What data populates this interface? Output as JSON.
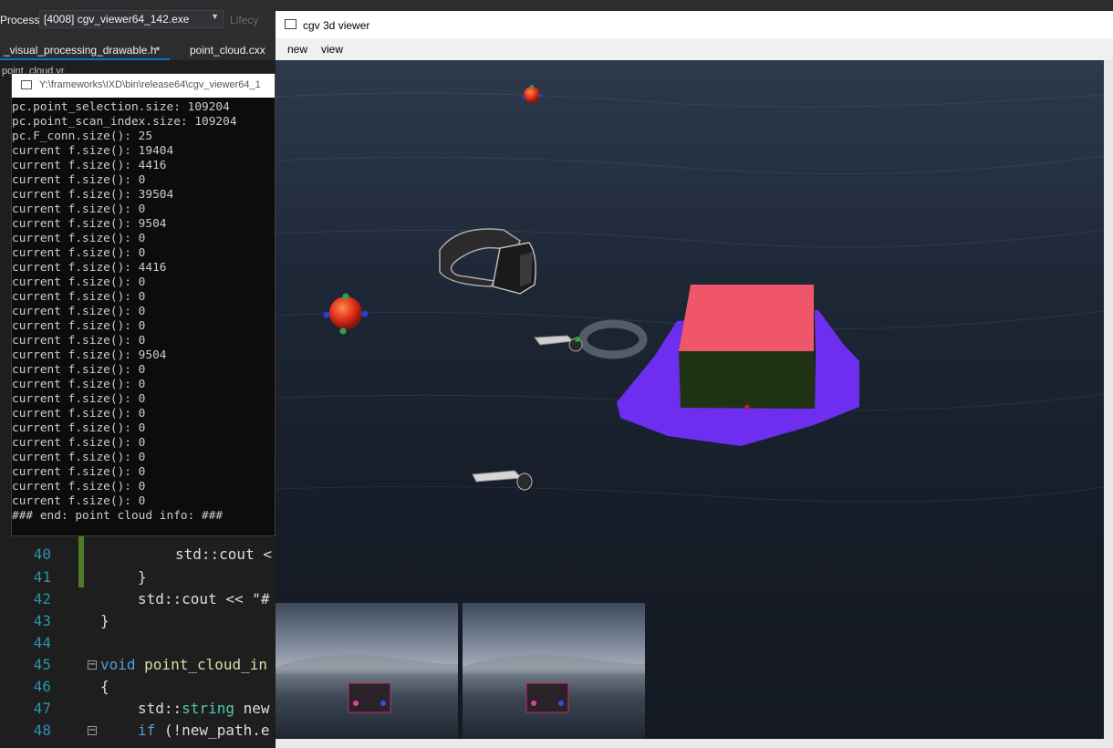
{
  "vs": {
    "process_label": "Process:",
    "process_value": "[4008] cgv_viewer64_142.exe",
    "lifecycle_label": "Lifecy",
    "tabs": [
      {
        "label": "_visual_processing_drawable.h"
      },
      {
        "label": "⭒"
      },
      {
        "label": "point_cloud.cxx"
      }
    ],
    "tab_row2": "point_cloud.vr"
  },
  "console": {
    "title": "Y:\\frameworks\\IXD\\bin\\release64\\cgv_viewer64_1",
    "lines": [
      "pc.point_selection.size: 109204",
      "pc.point_scan_index.size: 109204",
      "pc.F_conn.size(): 25",
      "current f.size(): 19404",
      "current f.size(): 4416",
      "current f.size(): 0",
      "current f.size(): 39504",
      "current f.size(): 0",
      "current f.size(): 9504",
      "current f.size(): 0",
      "current f.size(): 0",
      "current f.size(): 4416",
      "current f.size(): 0",
      "current f.size(): 0",
      "current f.size(): 0",
      "current f.size(): 0",
      "current f.size(): 0",
      "current f.size(): 9504",
      "current f.size(): 0",
      "current f.size(): 0",
      "current f.size(): 0",
      "current f.size(): 0",
      "current f.size(): 0",
      "current f.size(): 0",
      "current f.size(): 0",
      "current f.size(): 0",
      "current f.size(): 0",
      "current f.size(): 0",
      "### end: point cloud info: ###"
    ]
  },
  "editor": {
    "lines": [
      {
        "num": "40",
        "text": "std::cout <"
      },
      {
        "num": "41",
        "text": "}"
      },
      {
        "num": "42",
        "text": "std::cout << \"#"
      },
      {
        "num": "43",
        "text": "}"
      },
      {
        "num": "44",
        "text": ""
      },
      {
        "num": "45",
        "kw": "void",
        "fn": " point_cloud_in"
      },
      {
        "num": "46",
        "text": "{"
      },
      {
        "num": "47",
        "pre": "std::",
        "typ": "string",
        "post": " new"
      },
      {
        "num": "48",
        "kw": "if",
        "post": " (!new_path.e"
      }
    ]
  },
  "viewer": {
    "title": "cgv 3d viewer",
    "menu": [
      "new",
      "view"
    ]
  },
  "colors": {
    "box_top": "#f0566a",
    "box_side": "#1f3314",
    "platform": "#6d2ef0",
    "orb": "#e0301a"
  }
}
